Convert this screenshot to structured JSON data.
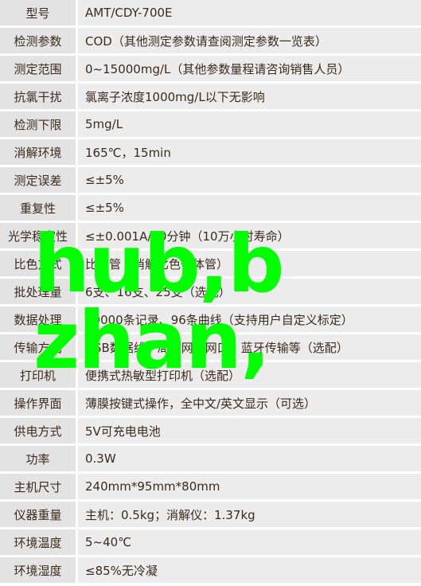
{
  "rows": [
    {
      "label": "型号",
      "value": "AMT/CDY-700E"
    },
    {
      "label": "检测参数",
      "value": "COD（其他测定参数请查阅测定参数一览表）"
    },
    {
      "label": "测定范围",
      "value": "0~15000mg/L（其他参数量程请咨询销售人员）"
    },
    {
      "label": "抗氯干扰",
      "value": "氯离子浓度1000mg/L以下无影响"
    },
    {
      "label": "检测下限",
      "value": "5mg/L"
    },
    {
      "label": "消解环境",
      "value": "165℃，15min"
    },
    {
      "label": "测定误差",
      "value": "≤±5%"
    },
    {
      "label": "重复性",
      "value": "≤±5%"
    },
    {
      "label": "光学稳定性",
      "value": "≤±0.001A/20分钟（10万小时寿命）"
    },
    {
      "label": "比色方式",
      "value": "比色管（消解比色一体管）"
    },
    {
      "label": "批处理量",
      "value": "6支、16支、25支（选配）"
    },
    {
      "label": "数据处理",
      "value": "30000条记录、96条曲线（支持用户自定义标定）"
    },
    {
      "label": "传输方式",
      "value": "USB数据线、局域网、网口、蓝牙传输等（选配）"
    },
    {
      "label": "打印机",
      "value": "便携式热敏型打印机（选配）"
    },
    {
      "label": "操作界面",
      "value": "薄膜按键式操作，全中文/英文显示（可选）"
    },
    {
      "label": "供电方式",
      "value": "5V可充电电池"
    },
    {
      "label": "功率",
      "value": "0.3W"
    },
    {
      "label": "主机尺寸",
      "value": "240mm*95mm*80mm"
    },
    {
      "label": "仪器重量",
      "value": "主机：0.5kg；消解仪：1.37kg"
    },
    {
      "label": "环境温度",
      "value": "5~40℃"
    },
    {
      "label": "环境湿度",
      "value": "≤85%无冷凝"
    }
  ],
  "watermark": {
    "line1": "hub,b",
    "line2": "zhan,",
    "color": "#00ff00"
  }
}
